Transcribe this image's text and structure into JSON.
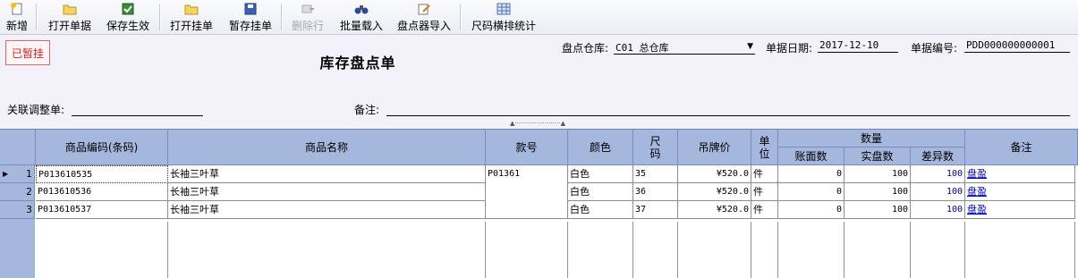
{
  "toolbar": {
    "new": "新增",
    "open_doc": "打开单据",
    "save_apply": "保存生效",
    "open_hold": "打开挂单",
    "hold": "暂存挂单",
    "delete_row": "删除行",
    "batch_import": "批量载入",
    "scanner_import": "盘点器导入",
    "size_stats": "尺码横排统计"
  },
  "form": {
    "status_stamp": "已暂挂",
    "title": "库存盘点单",
    "warehouse_label": "盘点仓库:",
    "warehouse_value": "C01 总仓库",
    "date_label": "单据日期:",
    "date_value": "2017-12-10",
    "docno_label": "单据编号:",
    "docno_value": "PDD000000000001",
    "related_label": "关联调整单:",
    "related_value": "",
    "remark_label": "备注:",
    "remark_value": ""
  },
  "grid": {
    "columns": {
      "code": "商品编码(条码)",
      "name": "商品名称",
      "style": "款号",
      "color": "颜色",
      "size": "尺码",
      "price": "吊牌价",
      "unit": "单位",
      "qty_group": "数量",
      "book_qty": "账面数",
      "actual_qty": "实盘数",
      "diff_qty": "差异数",
      "remark": "备注"
    },
    "rows": [
      {
        "no": "1",
        "code": "P013610535",
        "name": "长袖三叶草",
        "style": "P01361",
        "color": "白色",
        "size": "35",
        "price": "¥520.0",
        "unit": "件",
        "book": "0",
        "actual": "100",
        "diff": "100",
        "remark": "盘盈"
      },
      {
        "no": "2",
        "code": "P013610536",
        "name": "长袖三叶草",
        "style": "",
        "color": "白色",
        "size": "36",
        "price": "¥520.0",
        "unit": "件",
        "book": "0",
        "actual": "100",
        "diff": "100",
        "remark": "盘盈"
      },
      {
        "no": "3",
        "code": "P013610537",
        "name": "长袖三叶草",
        "style": "",
        "color": "白色",
        "size": "37",
        "price": "¥520.0",
        "unit": "件",
        "book": "0",
        "actual": "100",
        "diff": "100",
        "remark": "盘盈"
      }
    ]
  }
}
